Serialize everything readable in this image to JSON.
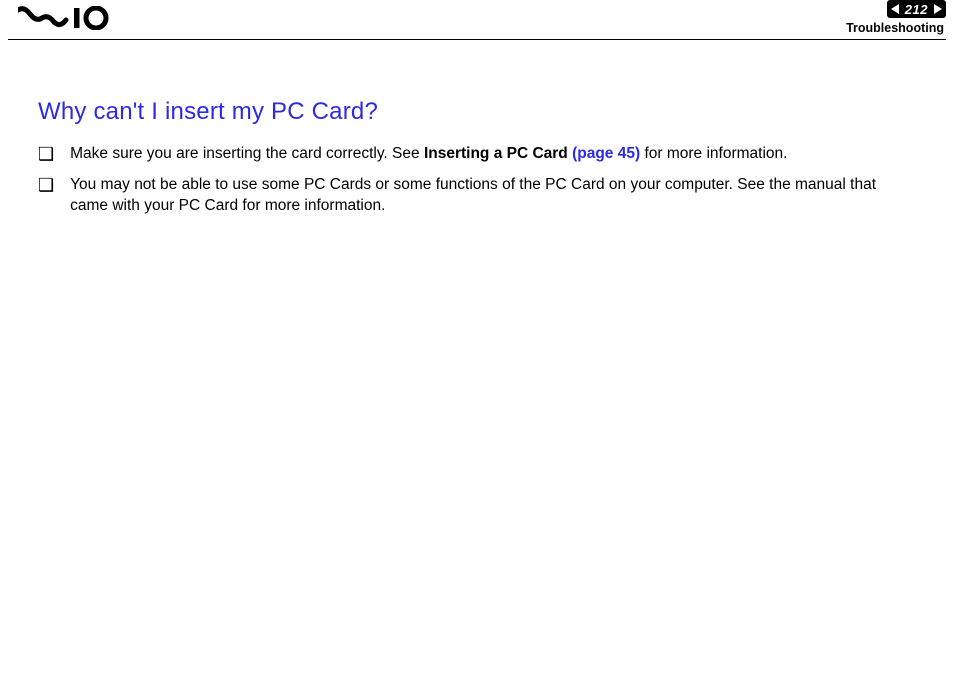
{
  "header": {
    "page_number": "212",
    "section": "Troubleshooting"
  },
  "content": {
    "heading": "Why can't I insert my PC Card?",
    "bullets": [
      {
        "pre": "Make sure you are inserting the card correctly. See ",
        "bold": "Inserting a PC Card ",
        "link": "(page 45)",
        "post": " for more information."
      },
      {
        "pre": "You may not be able to use some PC Cards or some functions of the PC Card on your computer. See the manual that came with your PC Card for more information.",
        "bold": "",
        "link": "",
        "post": ""
      }
    ]
  }
}
